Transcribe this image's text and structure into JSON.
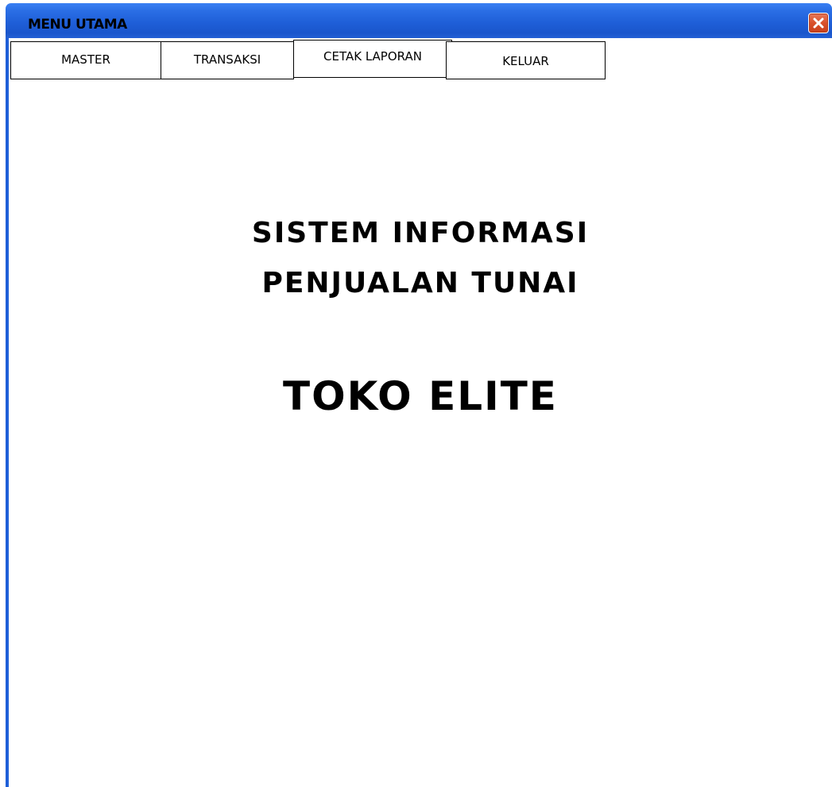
{
  "window": {
    "title": "MENU UTAMA",
    "close_icon": "close-icon"
  },
  "menu": {
    "items": [
      {
        "label": "MASTER"
      },
      {
        "label": "TRANSAKSI"
      },
      {
        "label": "CETAK LAPORAN"
      },
      {
        "label": "KELUAR"
      }
    ]
  },
  "content": {
    "line1": "SISTEM INFORMASI",
    "line2": "PENJUALAN TUNAI",
    "line3": "TOKO ELITE"
  },
  "colors": {
    "titlebar": "#1f5fd8",
    "close_button": "#d9512b"
  }
}
